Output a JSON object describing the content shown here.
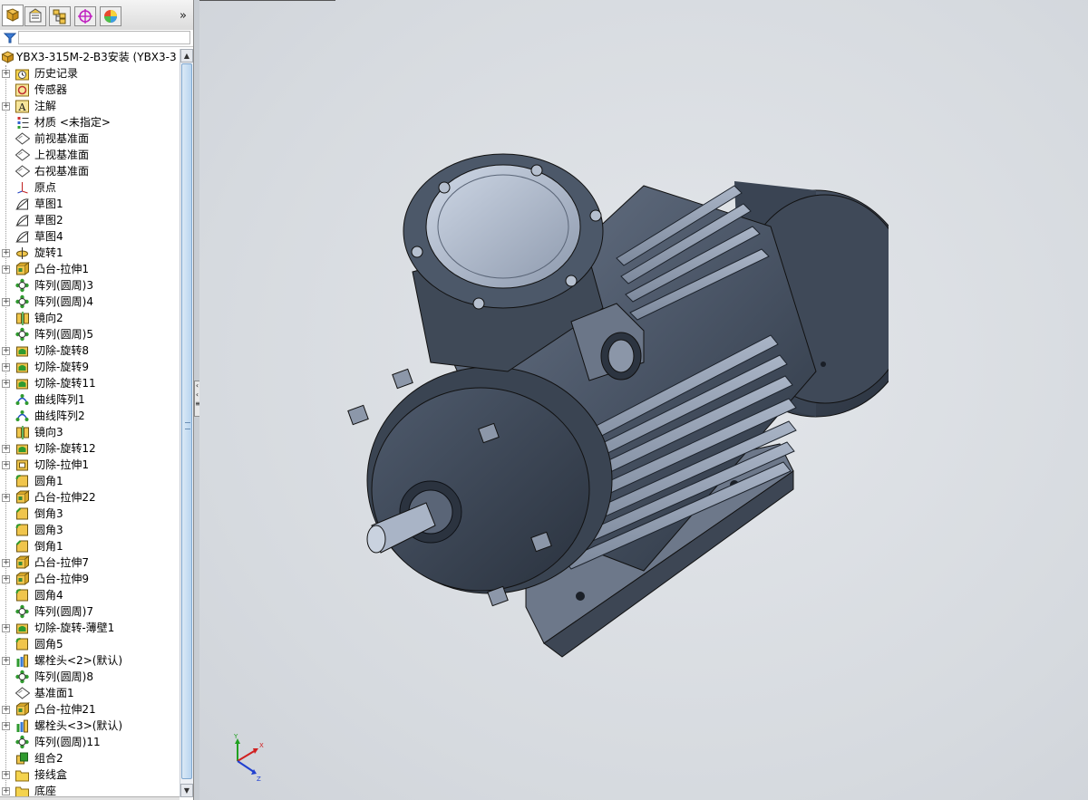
{
  "tabs": [
    {
      "name": "feature-manager-tab",
      "icon": "feature-tree-icon"
    },
    {
      "name": "property-manager-tab",
      "icon": "property-icon"
    },
    {
      "name": "configuration-manager-tab",
      "icon": "configuration-icon"
    },
    {
      "name": "dimxpert-tab",
      "icon": "dimxpert-icon"
    },
    {
      "name": "display-manager-tab",
      "icon": "appearance-icon"
    }
  ],
  "more_label": "»",
  "tree": {
    "root_label": "YBX3-315M-2-B3安装 (YBX3-3",
    "items": [
      {
        "label": "历史记录",
        "icon": "history-folder-icon",
        "expand": true
      },
      {
        "label": "传感器",
        "icon": "sensor-icon",
        "expand": false
      },
      {
        "label": "注解",
        "icon": "annotation-icon",
        "expand": true
      },
      {
        "label": "材质 <未指定>",
        "icon": "material-icon",
        "expand": false
      },
      {
        "label": "前视基准面",
        "icon": "plane-icon",
        "expand": false
      },
      {
        "label": "上视基准面",
        "icon": "plane-icon",
        "expand": false
      },
      {
        "label": "右视基准面",
        "icon": "plane-icon",
        "expand": false
      },
      {
        "label": "原点",
        "icon": "origin-icon",
        "expand": false
      },
      {
        "label": "草图1",
        "icon": "sketch-icon",
        "expand": false
      },
      {
        "label": "草图2",
        "icon": "sketch-icon",
        "expand": false
      },
      {
        "label": "草图4",
        "icon": "sketch-icon",
        "expand": false
      },
      {
        "label": "旋转1",
        "icon": "revolve-icon",
        "expand": true
      },
      {
        "label": "凸台-拉伸1",
        "icon": "extrude-icon",
        "expand": true
      },
      {
        "label": "阵列(圆周)3",
        "icon": "circular-pattern-icon",
        "expand": false
      },
      {
        "label": "阵列(圆周)4",
        "icon": "circular-pattern-icon",
        "expand": true
      },
      {
        "label": "镜向2",
        "icon": "mirror-icon",
        "expand": false
      },
      {
        "label": "阵列(圆周)5",
        "icon": "circular-pattern-icon",
        "expand": false
      },
      {
        "label": "切除-旋转8",
        "icon": "cut-revolve-icon",
        "expand": true
      },
      {
        "label": "切除-旋转9",
        "icon": "cut-revolve-icon",
        "expand": true
      },
      {
        "label": "切除-旋转11",
        "icon": "cut-revolve-icon",
        "expand": true
      },
      {
        "label": "曲线阵列1",
        "icon": "curve-pattern-icon",
        "expand": false
      },
      {
        "label": "曲线阵列2",
        "icon": "curve-pattern-icon",
        "expand": false
      },
      {
        "label": "镜向3",
        "icon": "mirror-icon",
        "expand": false
      },
      {
        "label": "切除-旋转12",
        "icon": "cut-revolve-icon",
        "expand": true
      },
      {
        "label": "切除-拉伸1",
        "icon": "cut-extrude-icon",
        "expand": true
      },
      {
        "label": "圆角1",
        "icon": "fillet-icon",
        "expand": false
      },
      {
        "label": "凸台-拉伸22",
        "icon": "extrude-icon",
        "expand": true
      },
      {
        "label": "倒角3",
        "icon": "chamfer-icon",
        "expand": false
      },
      {
        "label": "圆角3",
        "icon": "fillet-icon",
        "expand": false
      },
      {
        "label": "倒角1",
        "icon": "chamfer-icon",
        "expand": false
      },
      {
        "label": "凸台-拉伸7",
        "icon": "extrude-icon",
        "expand": true
      },
      {
        "label": "凸台-拉伸9",
        "icon": "extrude-icon",
        "expand": true
      },
      {
        "label": "圆角4",
        "icon": "fillet-icon",
        "expand": false
      },
      {
        "label": "阵列(圆周)7",
        "icon": "circular-pattern-icon",
        "expand": false
      },
      {
        "label": "切除-旋转-薄壁1",
        "icon": "cut-revolve-icon",
        "expand": true
      },
      {
        "label": "圆角5",
        "icon": "fillet-icon",
        "expand": false
      },
      {
        "label": "螺栓头<2>(默认)",
        "icon": "library-part-icon",
        "expand": true
      },
      {
        "label": "阵列(圆周)8",
        "icon": "circular-pattern-icon",
        "expand": false
      },
      {
        "label": "基准面1",
        "icon": "plane-icon",
        "expand": false
      },
      {
        "label": "凸台-拉伸21",
        "icon": "extrude-icon",
        "expand": true
      },
      {
        "label": "螺栓头<3>(默认)",
        "icon": "library-part-icon",
        "expand": true
      },
      {
        "label": "阵列(圆周)11",
        "icon": "circular-pattern-icon",
        "expand": false
      },
      {
        "label": "组合2",
        "icon": "combine-icon",
        "expand": false
      },
      {
        "label": "接线盒",
        "icon": "folder-icon",
        "expand": true
      },
      {
        "label": "底座",
        "icon": "folder-icon",
        "expand": true
      }
    ]
  },
  "triad": {
    "x": "X",
    "y": "Y",
    "z": "Z"
  },
  "colors": {
    "motor_body": "#4a5566",
    "motor_dark": "#2f3845",
    "motor_light": "#a9b4c6",
    "viewport_bg": "#d9dde2"
  }
}
